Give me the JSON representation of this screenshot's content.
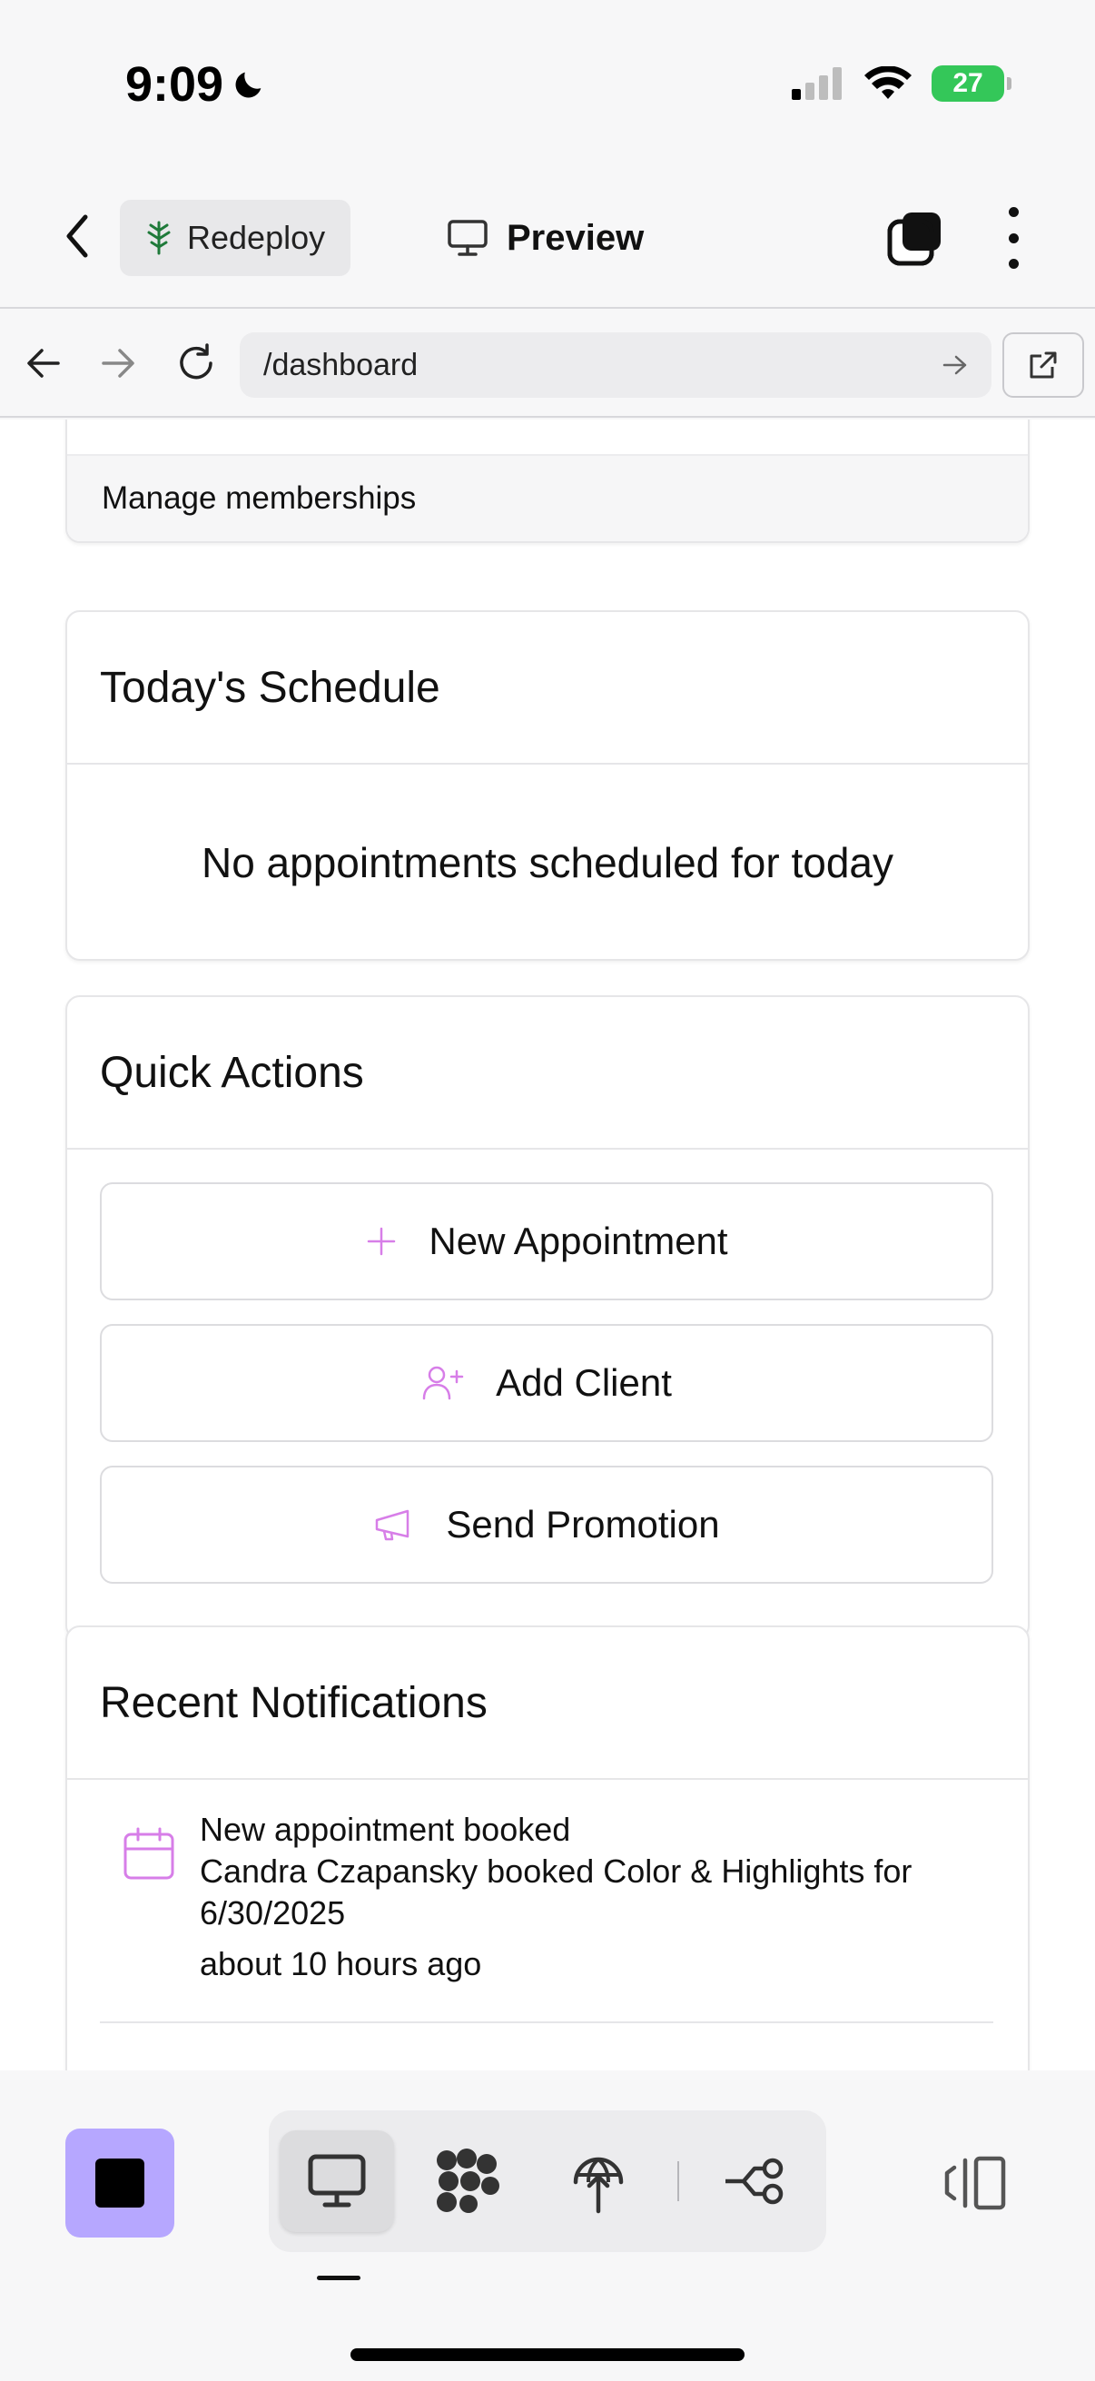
{
  "status_bar": {
    "time": "9:09",
    "battery": "27"
  },
  "header": {
    "redeploy_label": "Redeploy",
    "preview_label": "Preview"
  },
  "browser": {
    "url": "/dashboard"
  },
  "memberships": {
    "footer_link": "Manage memberships"
  },
  "schedule": {
    "title": "Today's Schedule",
    "empty_text": "No appointments scheduled for today"
  },
  "quick_actions": {
    "title": "Quick Actions",
    "buttons": [
      {
        "label": "New Appointment",
        "icon": "plus-icon"
      },
      {
        "label": "Add Client",
        "icon": "user-plus-icon"
      },
      {
        "label": "Send Promotion",
        "icon": "megaphone-icon"
      }
    ]
  },
  "notifications": {
    "title": "Recent Notifications",
    "items": [
      {
        "icon": "calendar-icon",
        "title": "New appointment booked",
        "body": "Candra Czapansky booked Color & Highlights for 6/30/2025",
        "time": "about 10 hours ago"
      }
    ]
  },
  "colors": {
    "accent_purple": "#b6a7ff",
    "icon_pink": "#d77ee8",
    "battery_green": "#34c759",
    "redeploy_green": "#1f7a3a"
  }
}
